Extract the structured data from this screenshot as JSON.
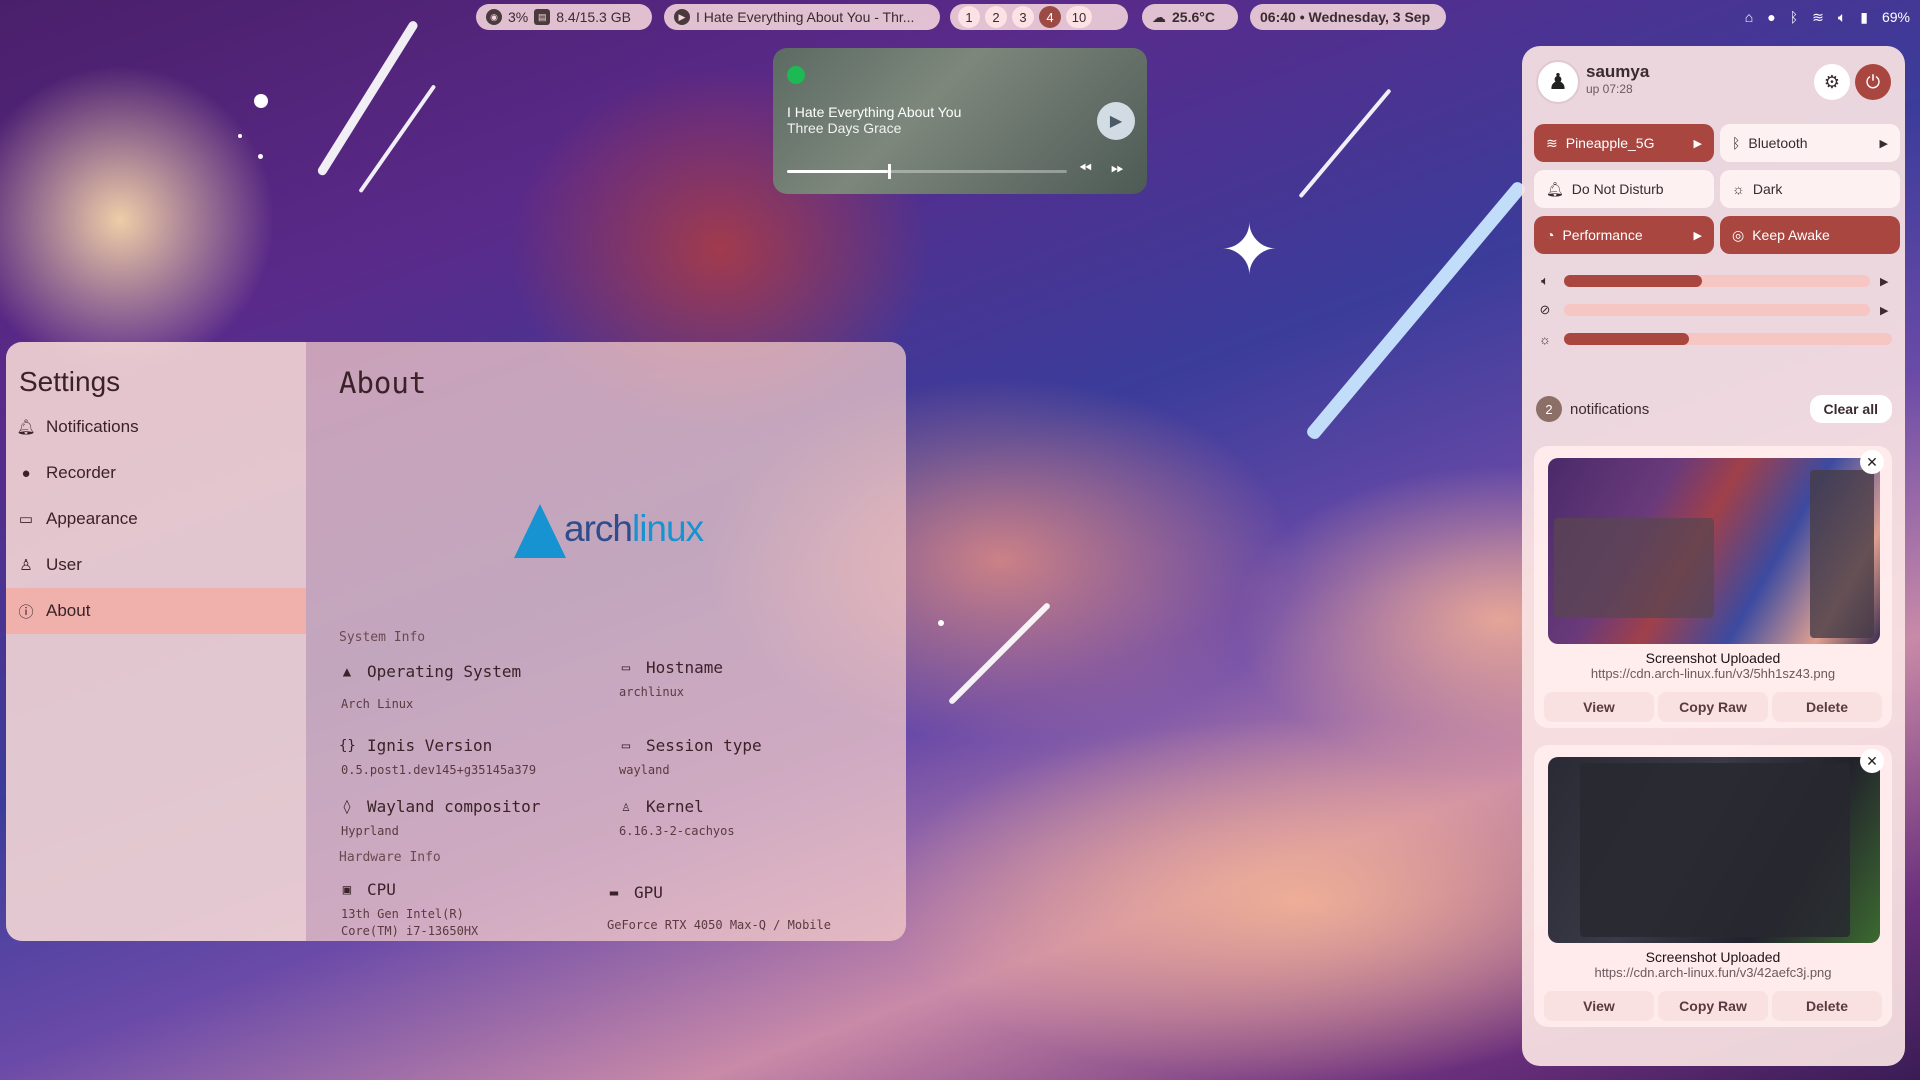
{
  "topbar": {
    "cpu": "3%",
    "memory": "8.4/15.3 GB",
    "now_playing": "I Hate Everything About You - Thr...",
    "workspaces": [
      "1",
      "2",
      "3",
      "4",
      "10"
    ],
    "active_workspace": "4",
    "weather": "25.6°C",
    "clock": "06:40 • Wednesday, 3 Sep",
    "battery": "69%",
    "tray_icons": [
      "discord-icon",
      "steam-icon",
      "bluetooth-icon",
      "wifi-icon",
      "volume-icon",
      "battery-icon"
    ]
  },
  "media": {
    "title": "I Hate Everything About You",
    "artist": "Three Days Grace",
    "progress": 0.36,
    "app_icon": "spotify-icon"
  },
  "settings": {
    "title": "Settings",
    "nav": [
      {
        "label": "Notifications",
        "icon": "bell-icon"
      },
      {
        "label": "Recorder",
        "icon": "record-icon"
      },
      {
        "label": "Appearance",
        "icon": "monitor-icon"
      },
      {
        "label": "User",
        "icon": "user-icon"
      },
      {
        "label": "About",
        "icon": "info-icon"
      }
    ],
    "active_nav": "About",
    "page_title": "About",
    "logo_text_a": "arch",
    "logo_text_b": "linux",
    "system_info_label": "System Info",
    "hardware_info_label": "Hardware Info",
    "os": {
      "title": "Operating System",
      "value": "Arch Linux"
    },
    "hostname": {
      "title": "Hostname",
      "value": "archlinux"
    },
    "ignis": {
      "title": "Ignis Version",
      "value": "0.5.post1.dev145+g35145a379"
    },
    "session": {
      "title": "Session type",
      "value": "wayland"
    },
    "compositor": {
      "title": "Wayland compositor",
      "value": "Hyprland"
    },
    "kernel": {
      "title": "Kernel",
      "value": "6.16.3-2-cachyos"
    },
    "cpu": {
      "title": "CPU",
      "value_line1": "13th Gen Intel(R)",
      "value_line2": "Core(TM) i7-13650HX"
    },
    "gpu": {
      "title": "GPU",
      "value": "GeForce RTX 4050 Max-Q / Mobile"
    }
  },
  "panel": {
    "username": "saumya",
    "uptime": "up 07:28",
    "tiles": [
      {
        "label": "Pineapple_5G",
        "state": "on",
        "has_arrow": true,
        "icon": "wifi-icon"
      },
      {
        "label": "Bluetooth",
        "state": "off",
        "has_arrow": true,
        "icon": "bluetooth-icon"
      },
      {
        "label": "Do Not Disturb",
        "state": "off",
        "has_arrow": false,
        "icon": "bell-icon"
      },
      {
        "label": "Dark",
        "state": "off",
        "has_arrow": false,
        "icon": "sun-icon"
      },
      {
        "label": "Performance",
        "state": "on",
        "has_arrow": true,
        "icon": "gauge-icon"
      },
      {
        "label": "Keep Awake",
        "state": "on",
        "has_arrow": false,
        "icon": "coffee-icon"
      }
    ],
    "sliders": {
      "volume": 0.45,
      "microphone": 0.0,
      "brightness": 0.38
    },
    "notifications_count": "2",
    "notifications_label": "notifications",
    "clear_all": "Clear all",
    "notifications": [
      {
        "title": "Screenshot Uploaded",
        "url": "https://cdn.arch-linux.fun/v3/5hh1sz43.png",
        "actions": [
          "View",
          "Copy Raw",
          "Delete"
        ]
      },
      {
        "title": "Screenshot Uploaded",
        "url": "https://cdn.arch-linux.fun/v3/42aefc3j.png",
        "actions": [
          "View",
          "Copy Raw",
          "Delete"
        ]
      }
    ]
  },
  "colors": {
    "accent": "#a9463f",
    "panel_bg": "#fae4e4",
    "arch_blue": "#1793d1"
  }
}
